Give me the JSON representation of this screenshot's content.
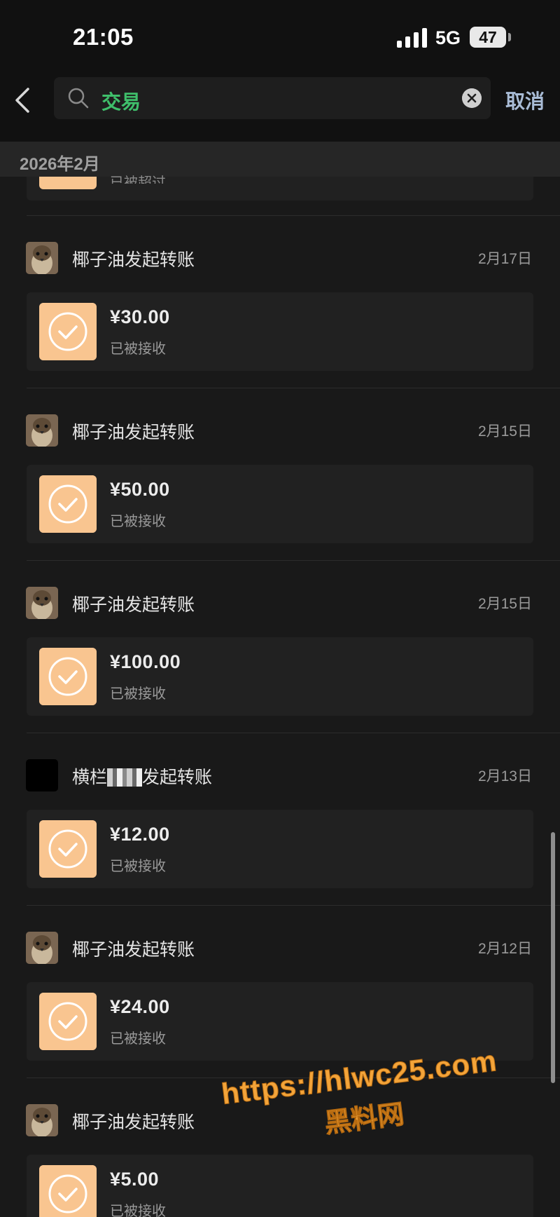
{
  "status_bar": {
    "time": "21:05",
    "network": "5G",
    "battery": "47"
  },
  "search": {
    "value": "交易",
    "cancel_label": "取消"
  },
  "month_label": "2026年2月",
  "partial_entry": {
    "status": "已被超过"
  },
  "entries": [
    {
      "sender": "椰子油发起转账",
      "date": "2月17日",
      "amount": "¥30.00",
      "status": "已被接收"
    },
    {
      "sender": "椰子油发起转账",
      "date": "2月15日",
      "amount": "¥50.00",
      "status": "已被接收"
    },
    {
      "sender": "椰子油发起转账",
      "date": "2月15日",
      "amount": "¥100.00",
      "status": "已被接收"
    },
    {
      "sender_prefix": "横栏",
      "sender_suffix": "发起转账",
      "date": "2月13日",
      "amount": "¥12.00",
      "status": "已被接收"
    },
    {
      "sender": "椰子油发起转账",
      "date": "2月12日",
      "amount": "¥24.00",
      "status": "已被接收"
    },
    {
      "sender": "椰子油发起转账",
      "date": "",
      "amount": "¥5.00",
      "status": "已被接收"
    }
  ],
  "watermark": {
    "url": "https://hlwc25.com",
    "name": "黑料网"
  },
  "colors": {
    "accent_green": "#3fbf6b",
    "transfer_icon": "#f9c590",
    "cancel_text": "#a9bcd6"
  }
}
